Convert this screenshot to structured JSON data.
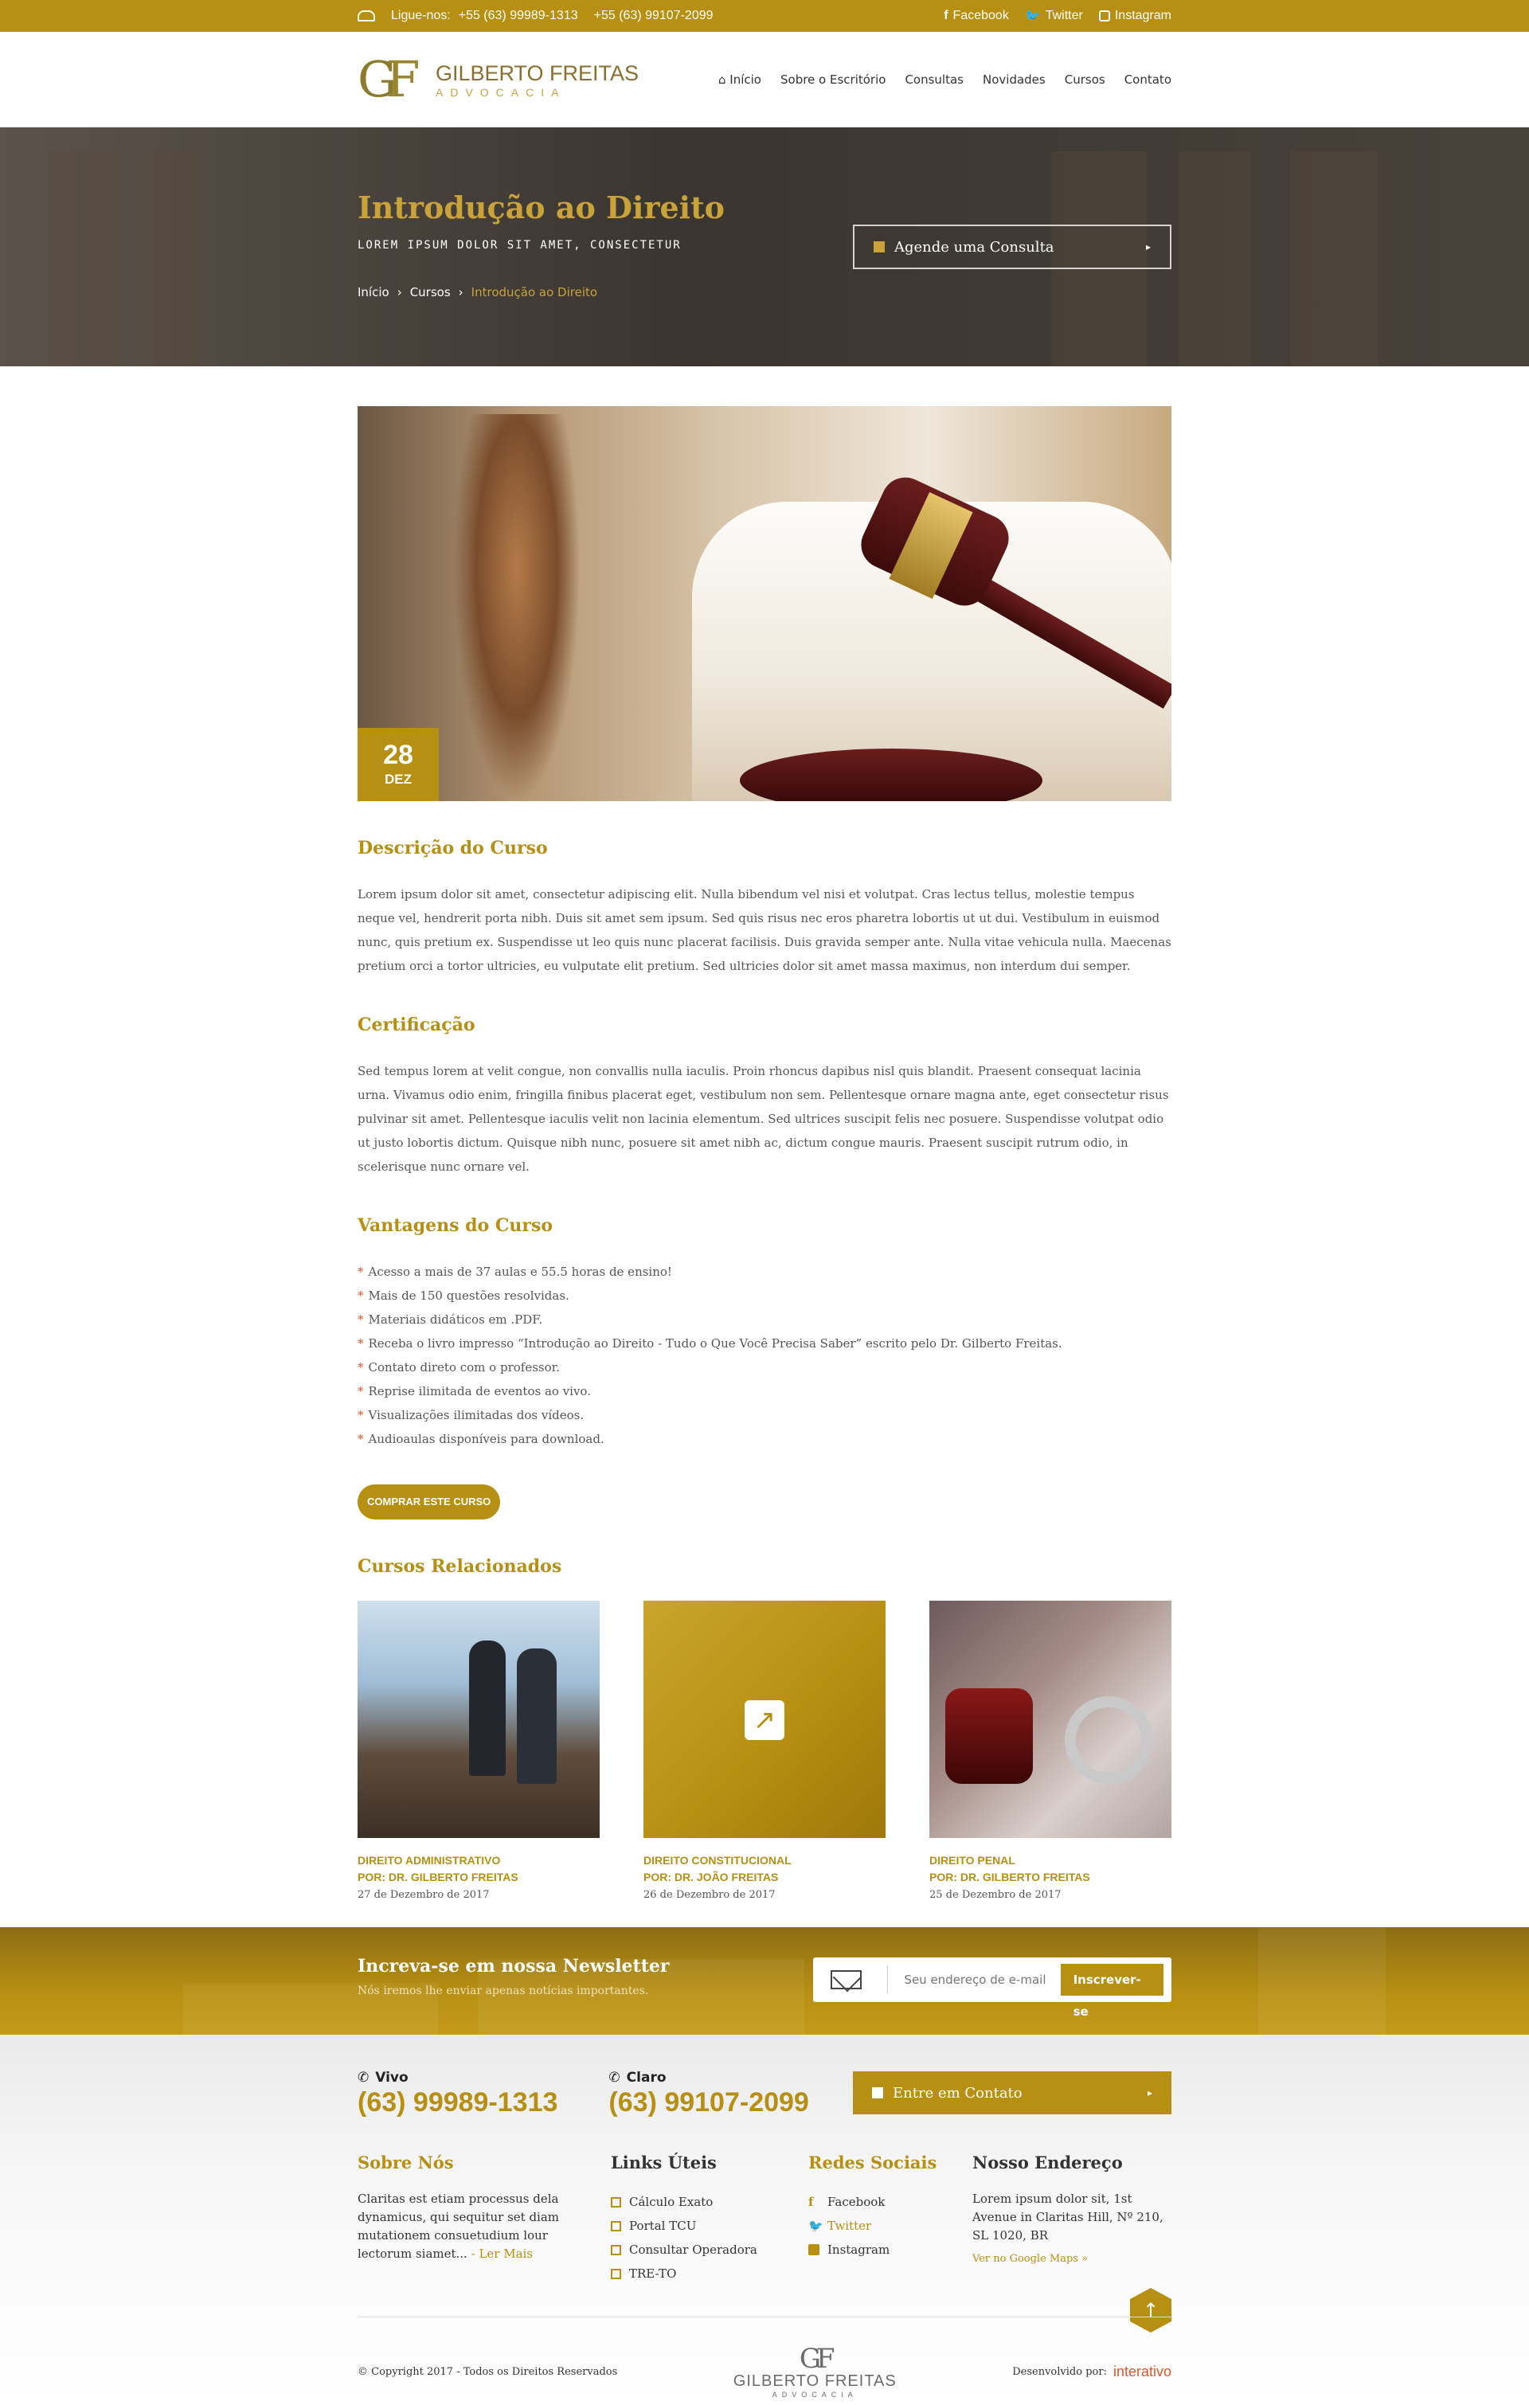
{
  "topbar": {
    "call_label": "Ligue-nos:",
    "phone1": "+55 (63) 99989-1313",
    "phone2": "+55 (63) 99107-2099",
    "social": [
      "Facebook",
      "Twitter",
      "Instagram"
    ]
  },
  "header": {
    "logo_mark_g": "G",
    "logo_mark_f": "F",
    "logo_name": "GILBERTO FREITAS",
    "logo_sub": "ADVOCACIA",
    "nav": [
      "Início",
      "Sobre o Escritório",
      "Consultas",
      "Novidades",
      "Cursos",
      "Contato"
    ]
  },
  "hero": {
    "title": "Introdução ao Direito",
    "subtitle": "LOREM IPSUM DOLOR SIT AMET, CONSECTETUR",
    "breadcrumb": [
      "Início",
      "Cursos",
      "Introdução ao Direito"
    ],
    "cta": "Agende uma Consulta"
  },
  "feature": {
    "day": "28",
    "month": "DEZ"
  },
  "description": {
    "heading": "Descrição do Curso",
    "text": "Lorem ipsum dolor sit amet, consectetur adipiscing elit. Nulla bibendum vel nisi et volutpat. Cras lectus tellus, molestie tempus neque vel, hendrerit porta nibh. Duis sit amet sem ipsum. Sed quis risus nec eros pharetra lobortis ut ut dui. Vestibulum in euismod nunc, quis pretium ex. Suspendisse ut leo quis nunc placerat facilisis. Duis gravida semper ante. Nulla vitae vehicula nulla. Maecenas pretium orci a tortor ultricies, eu vulputate elit pretium. Sed ultricies dolor sit amet massa maximus, non interdum dui semper."
  },
  "certification": {
    "heading": "Certificação",
    "text": "Sed tempus lorem at velit congue, non convallis nulla iaculis. Proin rhoncus dapibus nisl quis blandit. Praesent consequat lacinia urna. Vivamus odio enim, fringilla finibus placerat eget, vestibulum non sem. Pellentesque ornare magna ante, eget consectetur risus pulvinar sit amet. Pellentesque iaculis velit non lacinia elementum. Sed ultrices suscipit felis nec posuere. Suspendisse volutpat odio ut justo lobortis dictum. Quisque nibh nunc, posuere sit amet nibh ac, dictum congue mauris. Praesent suscipit rutrum odio, in scelerisque nunc ornare vel."
  },
  "advantages": {
    "heading": "Vantagens do Curso",
    "items": [
      "Acesso a mais de 37 aulas e 55.5 horas de ensino!",
      "Mais de 150 questões resolvidas.",
      "Materiais didáticos em .PDF.",
      "Receba o livro impresso “Introdução ao Direito - Tudo o Que Você Precisa Saber” escrito pelo Dr. Gilberto Freitas.",
      "Contato direto com o professor.",
      "Reprise ilimitada de eventos ao vivo.",
      "Visualizações ilimitadas dos vídeos.",
      "Audioaulas disponíveis para download."
    ],
    "buy_label": "COMPRAR ESTE CURSO"
  },
  "related": {
    "heading": "Cursos Relacionados",
    "cards": [
      {
        "title": "DIREITO ADMINISTRATIVO",
        "author": "POR: DR. GILBERTO FREITAS",
        "date": "27 de Dezembro de 2017"
      },
      {
        "title": "DIREITO CONSTITUCIONAL",
        "author": "POR: DR. JOÃO FREITAS",
        "date": "26 de Dezembro de 2017"
      },
      {
        "title": "DIREITO PENAL",
        "author": "POR: DR. GILBERTO FREITAS",
        "date": "25 de Dezembro de 2017"
      }
    ]
  },
  "newsletter": {
    "heading": "Increva-se em nossa Newsletter",
    "note": "Nós iremos lhe enviar apenas notícias importantes.",
    "placeholder": "Seu endereço de e-mail",
    "button": "Inscrever-se"
  },
  "footer": {
    "op1": "Vivo",
    "num1": "(63) 99989-1313",
    "op2": "Claro",
    "num2": "(63) 99107-2099",
    "cta": "Entre em Contato",
    "about_heading": "Sobre Nós",
    "about_text": "Claritas est etiam processus dela dynamicus, qui sequitur set diam mutationem consuetudium lour lectorum siamet...",
    "about_more": "- Ler Mais",
    "links_heading": "Links Úteis",
    "links": [
      "Cálculo Exato",
      "Portal TCU",
      "Consultar Operadora",
      "TRE-TO"
    ],
    "social_heading": "Redes Sociais",
    "social": [
      "Facebook",
      "Twitter",
      "Instagram"
    ],
    "address_heading": "Nosso Endereço",
    "address": "Lorem ipsum dolor sit, 1st Avenue in Claritas Hill, Nº 210, SL 1020, BR",
    "map_link": "Ver no Google Maps »",
    "copyright": "© Copyright 2017 - Todos os Direitos Reservados",
    "footer_logo_mark": "GF",
    "footer_logo_name": "GILBERTO FREITAS",
    "footer_logo_sub": "ADVOCACIA",
    "dev_label": "Desenvolvido por:",
    "dev_brand": "interativo"
  },
  "colors": {
    "accent": "#b78f12",
    "bullet": "#d9582b"
  }
}
